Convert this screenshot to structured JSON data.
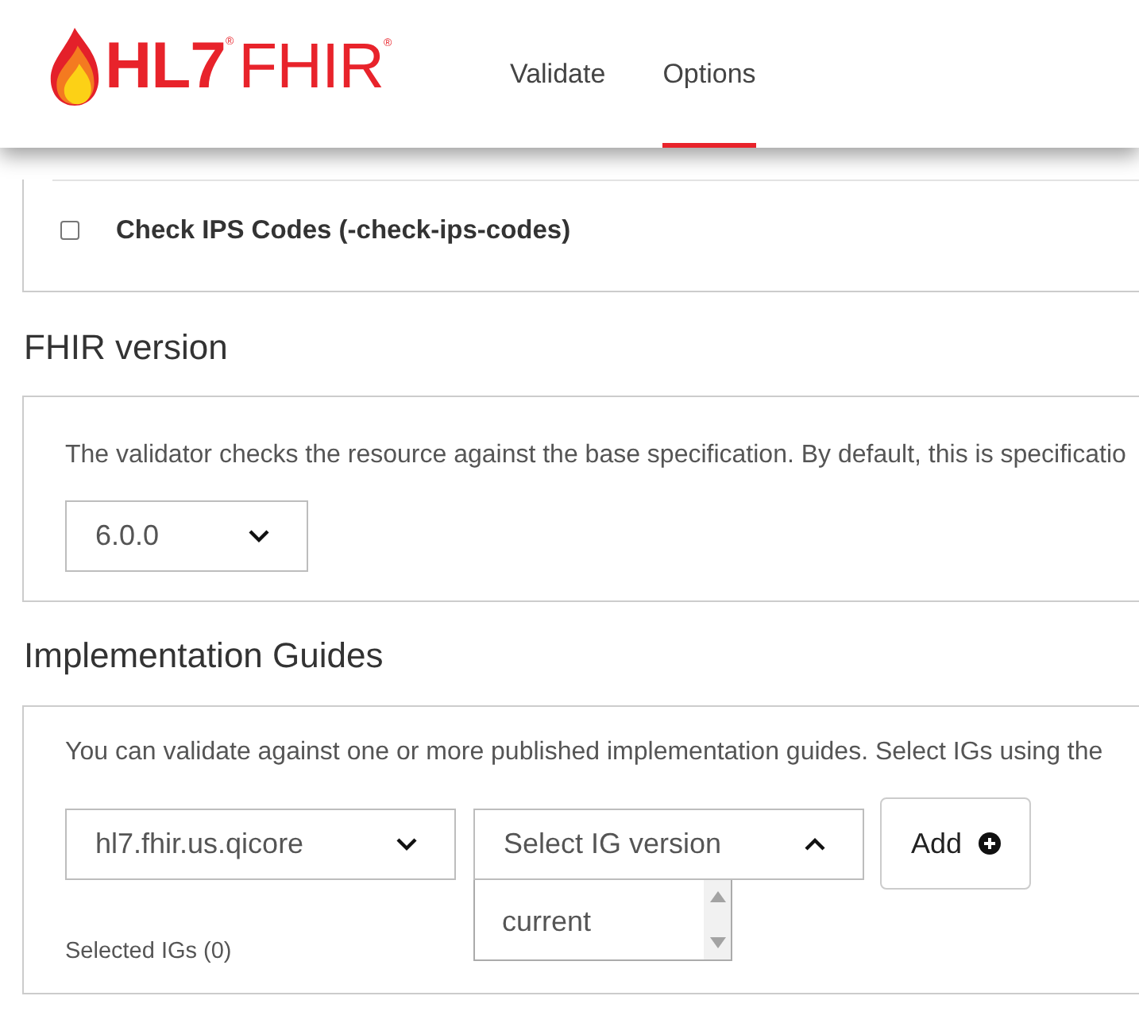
{
  "header": {
    "logo": {
      "mark": "HL7$^{®}$",
      "wordmark": "FHIR$^{®}$"
    },
    "nav": [
      {
        "label": "Validate",
        "selected": false
      },
      {
        "label": "Options",
        "selected": true
      }
    ]
  },
  "sections": [
    {
      "kind": "flags",
      "flags": [
        {
          "label": "Check IPS Codes (-check-ips-codes)",
          "checked": false
        }
      ]
    },
    {
      "kind": "fhir_version",
      "heading": "FHIR version",
      "description": "The validator checks the resource against the base specification. By default, this is specificatio",
      "version_select": {
        "value": "6.0.0",
        "expanded": false
      }
    },
    {
      "kind": "implementation_guides",
      "heading": "Implementation Guides",
      "description": "You can validate against one or more published implementation guides. Select IGs using the",
      "ig_select": {
        "value": "hl7.fhir.us.qicore",
        "expanded": false
      },
      "ig_version_select": {
        "prompt": "Select IG version",
        "expanded": true,
        "options": [
          "current"
        ]
      },
      "add_button": "Add",
      "selected_igs": "Selected IGs (0)"
    }
  ]
}
